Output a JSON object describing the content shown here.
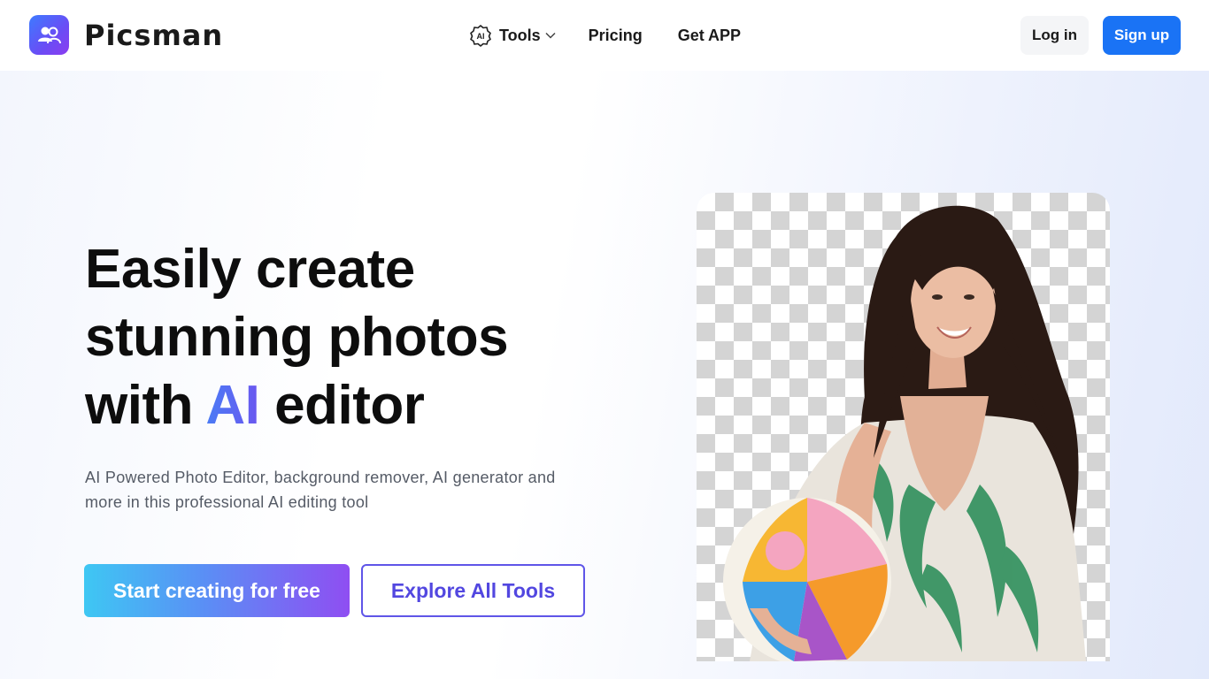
{
  "brand": {
    "name": "Picsman",
    "logo_icon": "users-photo-icon",
    "gradient": [
      "#3d7bff",
      "#8b3df0"
    ]
  },
  "nav": {
    "tools_label": "Tools",
    "tools_icon": "ai-badge-icon",
    "pricing_label": "Pricing",
    "get_app_label": "Get APP"
  },
  "auth": {
    "login_label": "Log in",
    "signup_label": "Sign up",
    "signup_color": "#1a73f5"
  },
  "hero": {
    "title_line1": "Easily create",
    "title_line2": "stunning photos",
    "title_pre": "with ",
    "title_accent": "AI",
    "title_post": " editor",
    "subtitle": "AI Powered Photo Editor, background remover, AI generator and more in this professional AI editing tool",
    "primary_cta": "Start creating for free",
    "secondary_cta": "Explore All Tools",
    "accent_color": "#5a6cf2"
  },
  "showcase": {
    "image_desc": "woman-with-beach-ball-photo",
    "background": "transparency-checkerboard"
  }
}
